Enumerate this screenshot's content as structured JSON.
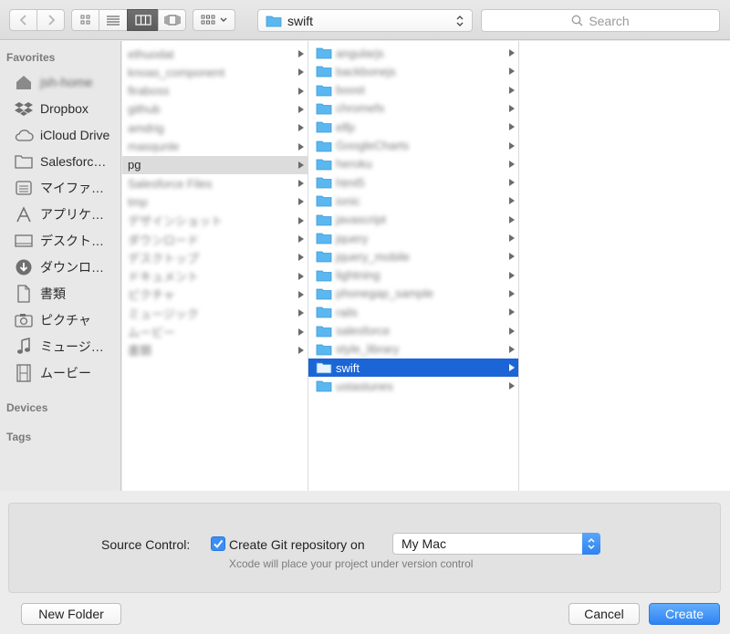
{
  "toolbar": {
    "back_icon": "chevron-left",
    "forward_icon": "chevron-right",
    "path_label": "swift",
    "search_placeholder": "Search"
  },
  "sidebar": {
    "favorites_header": "Favorites",
    "devices_header": "Devices",
    "tags_header": "Tags",
    "items": [
      {
        "label": "jsh-home",
        "icon": "home-icon",
        "redacted": true
      },
      {
        "label": "Dropbox",
        "icon": "dropbox-icon"
      },
      {
        "label": "iCloud Drive",
        "icon": "cloud-icon"
      },
      {
        "label": "Salesforc…",
        "icon": "folder-icon"
      },
      {
        "label": "マイファ…",
        "icon": "all-files-icon"
      },
      {
        "label": "アプリケ…",
        "icon": "applications-icon"
      },
      {
        "label": "デスクト…",
        "icon": "desktop-icon"
      },
      {
        "label": "ダウンロ…",
        "icon": "download-icon"
      },
      {
        "label": "書類",
        "icon": "documents-icon"
      },
      {
        "label": "ピクチャ",
        "icon": "camera-icon"
      },
      {
        "label": "ミュージ…",
        "icon": "music-icon"
      },
      {
        "label": "ムービー",
        "icon": "movie-icon"
      }
    ]
  },
  "column1": {
    "rows": [
      {
        "name": "ethuodat",
        "redacted": true
      },
      {
        "name": "knoas_component",
        "redacted": true
      },
      {
        "name": "firaboss",
        "redacted": true
      },
      {
        "name": "github",
        "redacted": true
      },
      {
        "name": "amdrig",
        "redacted": true
      },
      {
        "name": "masqunle",
        "redacted": true
      },
      {
        "name": "pg",
        "highlighted": true
      },
      {
        "name": "Salesforce Files",
        "redacted": true
      },
      {
        "name": "tmp",
        "redacted": true
      },
      {
        "name": "デザインショット",
        "redacted": true
      },
      {
        "name": "ダウンロード",
        "redacted": true
      },
      {
        "name": "デスクトップ",
        "redacted": true
      },
      {
        "name": "ドキュメント",
        "redacted": true
      },
      {
        "name": "ピクチャ",
        "redacted": true
      },
      {
        "name": "ミュージック",
        "redacted": true
      },
      {
        "name": "ムービー",
        "redacted": true
      },
      {
        "name": "書類",
        "redacted": true
      }
    ]
  },
  "column2": {
    "rows": [
      {
        "name": "angularjs",
        "redacted": true
      },
      {
        "name": "backbonejs",
        "redacted": true
      },
      {
        "name": "boost",
        "redacted": true
      },
      {
        "name": "chromefx",
        "redacted": true
      },
      {
        "name": "elfp",
        "redacted": true
      },
      {
        "name": "GoogleCharts",
        "redacted": true
      },
      {
        "name": "heroku",
        "redacted": true
      },
      {
        "name": "html5",
        "redacted": true
      },
      {
        "name": "ionic",
        "redacted": true
      },
      {
        "name": "javascript",
        "redacted": true
      },
      {
        "name": "jquery",
        "redacted": true
      },
      {
        "name": "jquery_mobile",
        "redacted": true
      },
      {
        "name": "lightning",
        "redacted": true
      },
      {
        "name": "phonegap_sample",
        "redacted": true
      },
      {
        "name": "rails",
        "redacted": true
      },
      {
        "name": "salesforce",
        "redacted": true
      },
      {
        "name": "style_library",
        "redacted": true
      },
      {
        "name": "swift",
        "selected": true
      },
      {
        "name": "ustastunes",
        "redacted": true
      }
    ]
  },
  "bottom": {
    "source_control_label": "Source Control:",
    "checkbox_label": "Create Git repository on",
    "checkbox_checked": true,
    "location_value": "My Mac",
    "hint": "Xcode will place your project under version control"
  },
  "buttons": {
    "new_folder": "New Folder",
    "cancel": "Cancel",
    "create": "Create"
  },
  "colors": {
    "accent": "#1b65d6",
    "folder": "#5ab7f0"
  }
}
